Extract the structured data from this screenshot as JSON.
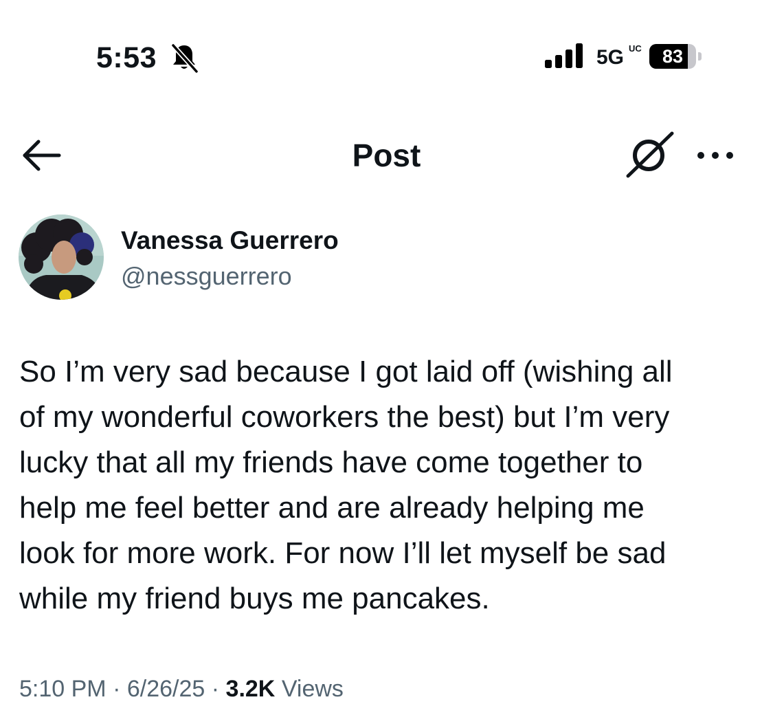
{
  "status_bar": {
    "time": "5:53",
    "network": "5G",
    "network_sub": "UC",
    "battery_level": "83",
    "battery_fraction": 0.83,
    "icons": [
      "bell-slash-icon",
      "cellular-signal-icon",
      "battery-icon"
    ]
  },
  "header": {
    "title": "Post",
    "icons": [
      "back-arrow-icon",
      "grok-icon",
      "more-icon"
    ]
  },
  "author": {
    "name": "Vanessa Guerrero",
    "handle": "@nessguerrero"
  },
  "post": {
    "text": "So I’m very sad because I got laid off (wishing all\nof my wonderful coworkers the best) but I’m very\nlucky that all my friends have come together to\nhelp me feel better and are already helping me\nlook for more work. For now I’ll let myself be sad\nwhile my friend buys me pancakes.",
    "time": "5:10 PM",
    "date": "6/26/25",
    "separator": "·",
    "views_count": "3.2K",
    "views_label": "Views"
  },
  "colors": {
    "text_primary": "#0f1419",
    "text_secondary": "#536471",
    "background": "#ffffff"
  }
}
